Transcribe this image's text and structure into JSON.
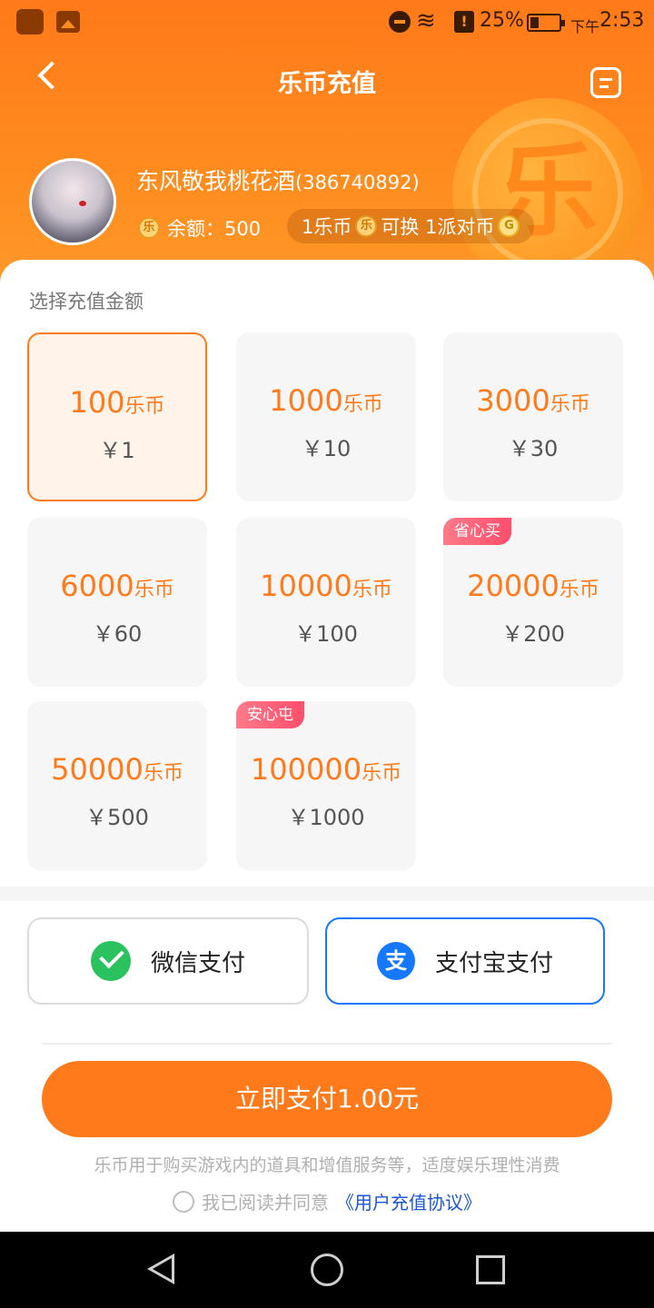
{
  "status_bar": {
    "battery": "25%",
    "time_prefix": "下午",
    "time": "2:53"
  },
  "header": {
    "title": "乐币充值",
    "coin_glyph": "乐",
    "user": {
      "name": "东风敬我桃花酒",
      "id": "(386740892)"
    },
    "balance_label": "余额：500",
    "exchange": {
      "left": "1乐币",
      "mid": "可换 1派对币",
      "coin_small_glyph": "乐",
      "party_coin_glyph": "G"
    }
  },
  "section_label": "选择充值金额",
  "unit": "乐币",
  "options": [
    {
      "amount": "100",
      "price": "￥1",
      "selected": true
    },
    {
      "amount": "1000",
      "price": "￥10"
    },
    {
      "amount": "3000",
      "price": "￥30"
    },
    {
      "amount": "6000",
      "price": "￥60"
    },
    {
      "amount": "10000",
      "price": "￥100"
    },
    {
      "amount": "20000",
      "price": "￥200",
      "badge": "省心买"
    },
    {
      "amount": "50000",
      "price": "￥500"
    },
    {
      "amount": "100000",
      "price": "￥1000",
      "badge": "安心屯"
    }
  ],
  "payment": {
    "wechat_label": "微信支付",
    "alipay_label": "支付宝支付",
    "alipay_glyph": "支",
    "selected": "alipay"
  },
  "pay_button": "立即支付1.00元",
  "tip": "乐币用于购买游戏内的道具和增值服务等，适度娱乐理性消费",
  "agreement": {
    "prefix": "我已阅读并同意",
    "link": "《用户充值协议》"
  },
  "colors": {
    "accent": "#ff7a1a",
    "alipay": "#1677ff",
    "wechat": "#2ac25e",
    "badge": "#ff4e6c"
  },
  "icons": [
    "back-arrow-icon",
    "menu-icon",
    "coin-icon",
    "wechat-pay-icon",
    "alipay-icon",
    "nav-back-icon",
    "nav-home-icon",
    "nav-recent-icon"
  ]
}
